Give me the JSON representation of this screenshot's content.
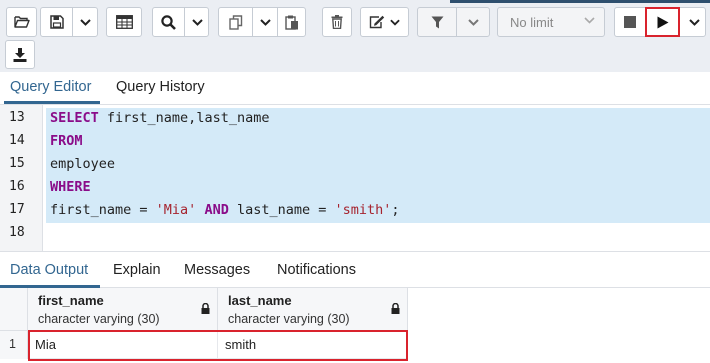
{
  "toolbar": {
    "icons": [
      "open-file-icon",
      "save-icon",
      "chevron-down-icon",
      "table-icon",
      "search-icon",
      "chevron-down-icon",
      "copy-icon",
      "chevron-down-icon",
      "paste-icon",
      "delete-icon",
      "edit-icon",
      "chevron-down-icon",
      "filter-icon",
      "chevron-down-icon",
      "stop-icon",
      "play-icon",
      "chevron-down-icon",
      "download-icon"
    ],
    "limit_value": "No limit",
    "accent_color": "#d9232d"
  },
  "query_tabs": [
    "Query Editor",
    "Query History"
  ],
  "editor": {
    "lines": [
      {
        "number": "13",
        "tokens": [
          {
            "t": "SELECT",
            "k": "kw"
          },
          {
            "t": " first_name,last_name",
            "k": ""
          }
        ]
      },
      {
        "number": "14",
        "tokens": [
          {
            "t": "FROM",
            "k": "kw"
          }
        ]
      },
      {
        "number": "15",
        "tokens": [
          {
            "t": "employee",
            "k": ""
          }
        ]
      },
      {
        "number": "16",
        "tokens": [
          {
            "t": "WHERE",
            "k": "kw"
          }
        ]
      },
      {
        "number": "17",
        "tokens": [
          {
            "t": "first_name = ",
            "k": ""
          },
          {
            "t": "'Mia'",
            "k": "str"
          },
          {
            "t": " ",
            "k": ""
          },
          {
            "t": "AND",
            "k": "kw"
          },
          {
            "t": " last_name = ",
            "k": ""
          },
          {
            "t": "'smith'",
            "k": "str"
          },
          {
            "t": ";",
            "k": ""
          }
        ]
      },
      {
        "number": "18",
        "tokens": []
      }
    ]
  },
  "output_tabs": [
    "Data Output",
    "Explain",
    "Messages",
    "Notifications"
  ],
  "grid": {
    "columns": [
      {
        "name": "first_name",
        "type": "character varying (30)"
      },
      {
        "name": "last_name",
        "type": "character varying (30)"
      }
    ],
    "rows": [
      {
        "num": "1",
        "cells": [
          "Mia",
          "smith"
        ]
      }
    ]
  }
}
